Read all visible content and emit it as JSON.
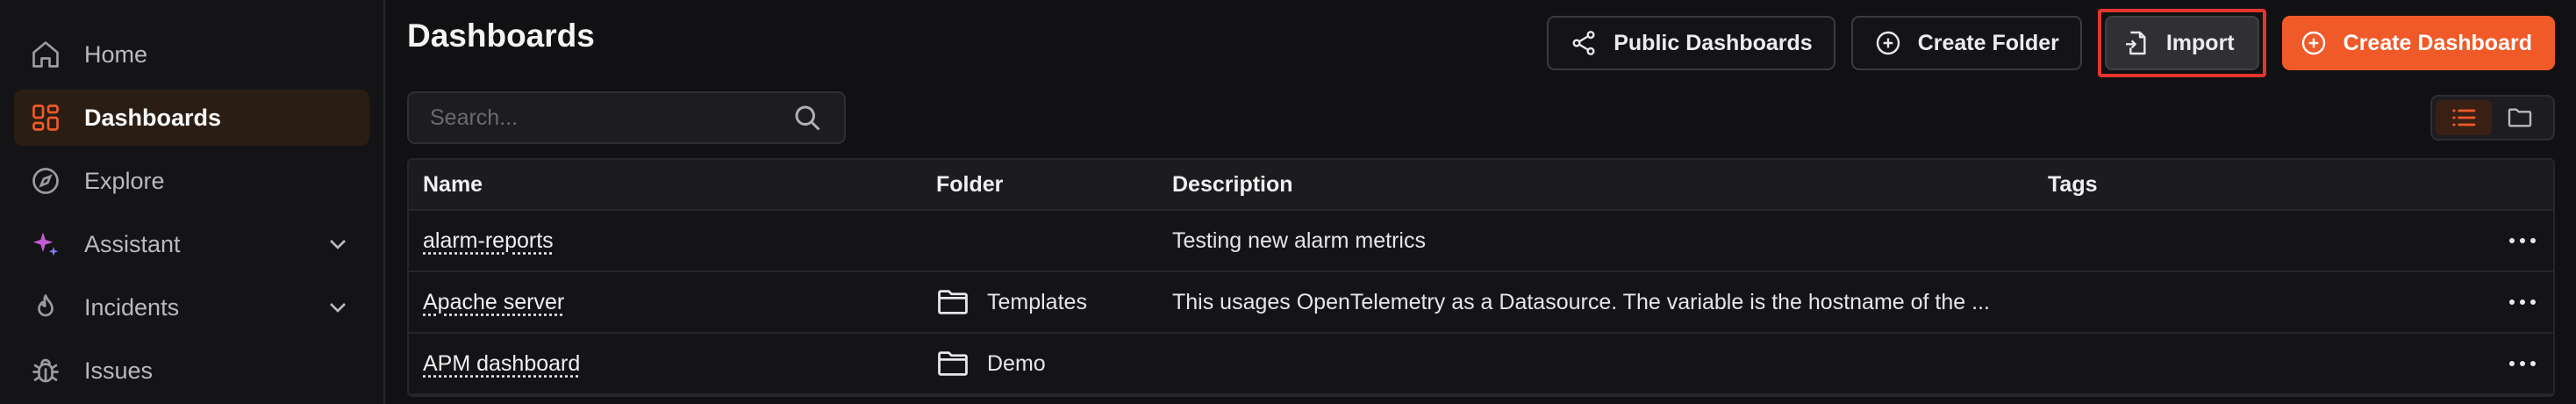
{
  "sidebar": {
    "items": [
      {
        "label": "Home",
        "icon": "home-icon"
      },
      {
        "label": "Dashboards",
        "icon": "dashboards-icon",
        "active": true
      },
      {
        "label": "Explore",
        "icon": "compass-icon"
      },
      {
        "label": "Assistant",
        "icon": "sparkle-icon",
        "expandable": true
      },
      {
        "label": "Incidents",
        "icon": "flame-icon",
        "expandable": true
      },
      {
        "label": "Issues",
        "icon": "bug-icon"
      }
    ]
  },
  "header": {
    "title": "Dashboards",
    "buttons": {
      "public": "Public Dashboards",
      "folder": "Create Folder",
      "import": "Import",
      "create": "Create Dashboard"
    }
  },
  "search": {
    "placeholder": "Search..."
  },
  "colors": {
    "accent": "#f05a28",
    "highlight": "#e5352f",
    "background": "#111113"
  },
  "table": {
    "columns": [
      "Name",
      "Folder",
      "Description",
      "Tags"
    ],
    "rows": [
      {
        "name": "alarm-reports",
        "folder": "",
        "description": "Testing new alarm metrics",
        "tags": ""
      },
      {
        "name": "Apache server",
        "folder": "Templates",
        "description": "This usages OpenTelemetry as a Datasource. The variable is the hostname of the ...",
        "tags": ""
      },
      {
        "name": "APM dashboard",
        "folder": "Demo",
        "description": "",
        "tags": ""
      }
    ]
  }
}
